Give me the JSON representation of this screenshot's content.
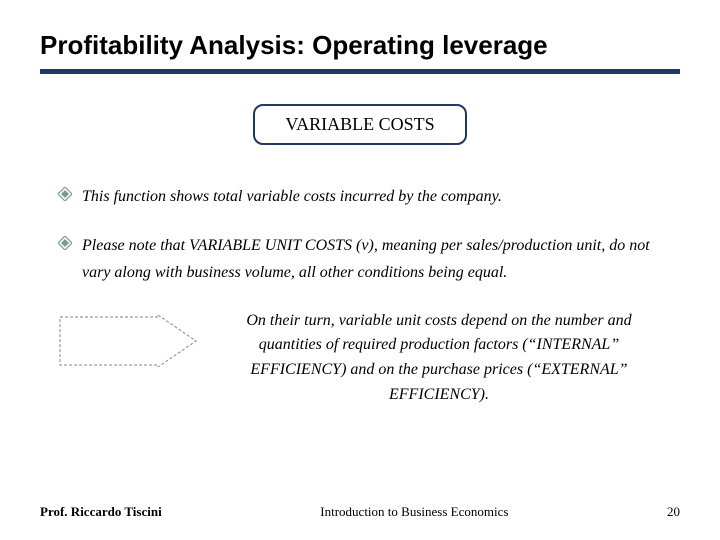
{
  "title": "Profitability Analysis: Operating leverage",
  "label": "VARIABLE COSTS",
  "bullets": [
    "This function shows total variable costs incurred by the company.",
    "Please note that VARIABLE UNIT COSTS (v), meaning per sales/production unit, do not vary along with business volume, all other conditions being equal."
  ],
  "paragraph": "On their turn, variable unit costs depend on the number and quantities of required production factors (“INTERNAL” EFFICIENCY) and on the purchase prices  (“EXTERNAL” EFFICIENCY).",
  "footer": {
    "left": "Prof. Riccardo Tiscini",
    "center": "Introduction to Business Economics",
    "page": "20"
  },
  "colors": {
    "accent": "#203864",
    "bullet": "#7a9b8e"
  }
}
